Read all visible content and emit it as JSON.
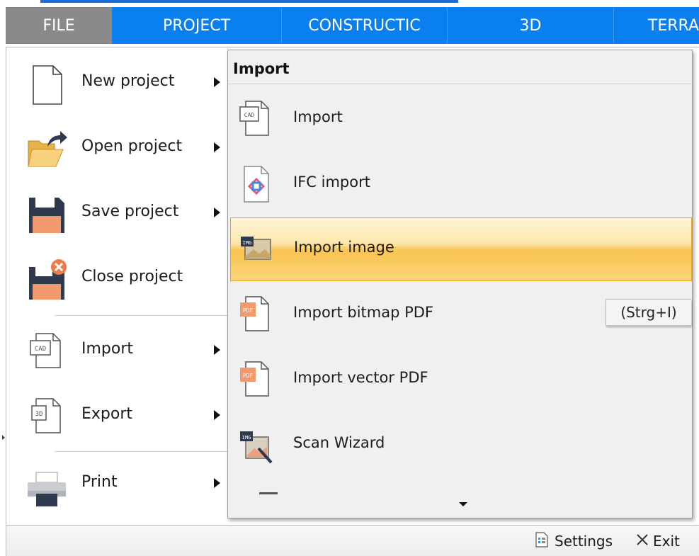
{
  "ribbon": {
    "tabs": [
      {
        "label": "FILE"
      },
      {
        "label": "PROJECT"
      },
      {
        "label": "CONSTRUCTIC"
      },
      {
        "label": "3D"
      },
      {
        "label": "TERRA"
      }
    ]
  },
  "file_menu": {
    "items": [
      {
        "label": "New project",
        "icon": "blank-page-icon",
        "has_submenu": true
      },
      {
        "label": "Open project",
        "icon": "open-folder-icon",
        "has_submenu": true
      },
      {
        "label": "Save project",
        "icon": "floppy-disk-icon",
        "has_submenu": true
      },
      {
        "label": "Close project",
        "icon": "close-floppy-icon",
        "has_submenu": false
      },
      {
        "label": "Import",
        "icon": "cad-file-icon",
        "has_submenu": true
      },
      {
        "label": "Export",
        "icon": "3d-file-icon",
        "has_submenu": true
      },
      {
        "label": "Print",
        "icon": "printer-icon",
        "has_submenu": true
      }
    ]
  },
  "import_submenu": {
    "title": "Import",
    "items": [
      {
        "label": "Import",
        "icon": "cad-file-icon"
      },
      {
        "label": "IFC import",
        "icon": "ifc-file-icon"
      },
      {
        "label": "Import image",
        "icon": "image-file-icon",
        "highlighted": true
      },
      {
        "label": "Import bitmap PDF",
        "icon": "pdf-file-icon"
      },
      {
        "label": "Import vector PDF",
        "icon": "pdf-file-icon"
      },
      {
        "label": "Scan Wizard",
        "icon": "scan-wizard-icon"
      }
    ]
  },
  "tooltip": {
    "shortcut": "(Strg+I)"
  },
  "footer": {
    "settings_label": "Settings",
    "exit_label": "Exit"
  },
  "colors": {
    "ribbon": "#0a7ff0",
    "file_tab": "#8a8a8a",
    "highlight": "#f9c452",
    "submenu_bg": "#f0f0f0"
  }
}
